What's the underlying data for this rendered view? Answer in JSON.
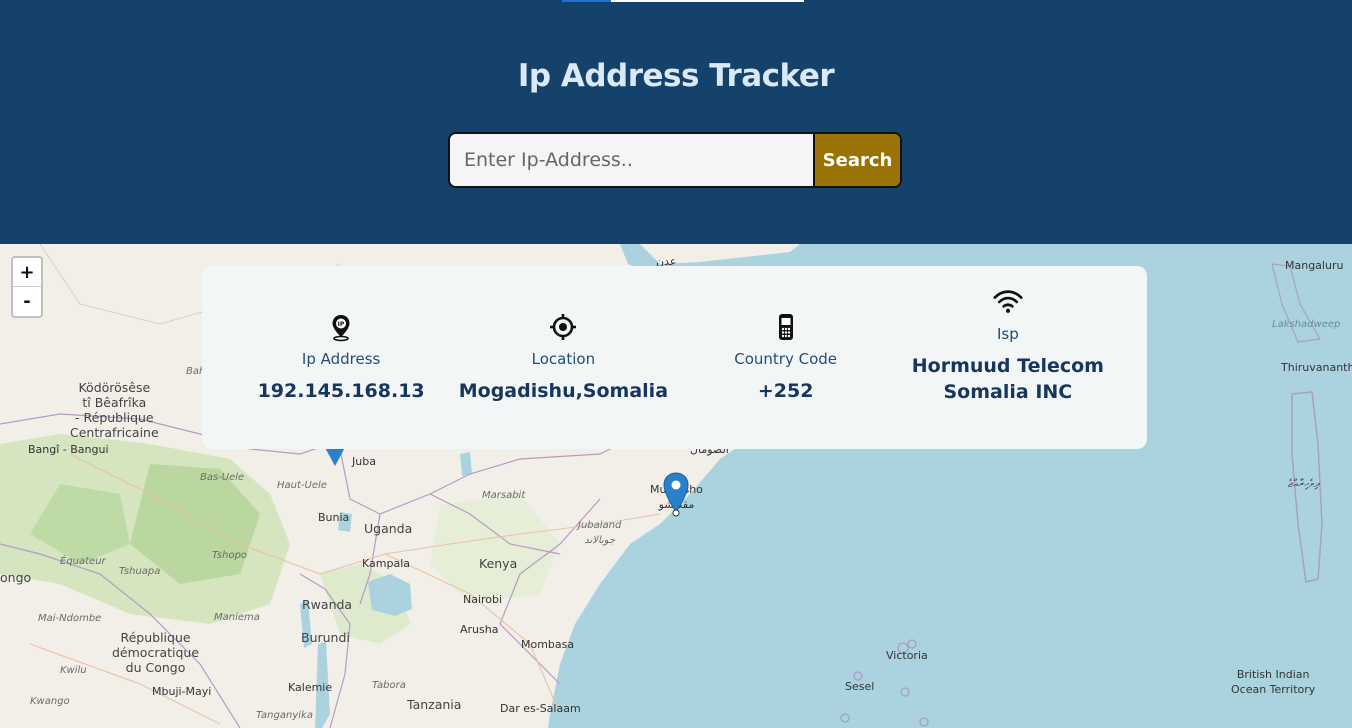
{
  "header": {
    "title": "Ip Address Tracker",
    "search": {
      "placeholder": "Enter Ip-Address..",
      "value": "",
      "button_label": "Search"
    }
  },
  "map": {
    "zoom_in_label": "+",
    "zoom_out_label": "-",
    "labels": {
      "aden": "عدن",
      "mangaluru": "Mangaluru",
      "lakshadweep": "Lakshadweep",
      "thiruvananth": "Thiruvananth",
      "kodorosese": "Ködörösêse\ntî Bêafrîka\n- République\nCentrafricaine",
      "bangui": "Bangî - Bangui",
      "bas_uele": "Bas-Uele",
      "haut_uele": "Haut-Uele",
      "juba": "Juba",
      "somali": "الصومال",
      "marsabit": "Marsabit",
      "mogadishu": "Muqdisho\nمقديشو",
      "bunia": "Bunia",
      "uganda": "Uganda",
      "kampala": "Kampala",
      "jubaland": "Jubaland\nجوبالاند",
      "equateur": "Équateur",
      "tshuapa": "Tshuapa",
      "tshopo": "Tshopo",
      "kenya": "Kenya",
      "ongo": "ongo",
      "rwanda": "Rwanda",
      "nairobi": "Nairobi",
      "mai_ndombe": "Mai-Ndombe",
      "maniema": "Maniema",
      "burundi": "Burundi",
      "arusha": "Arusha",
      "rdc": "République\ndémocratique\ndu Congo",
      "mombasa": "Mombasa",
      "kwilu": "Kwilu",
      "victoria": "Victoria",
      "mbuji_mayi": "Mbuji-Mayi",
      "kalemie": "Kalemie",
      "tabora": "Tabora",
      "sesel": "Sesel",
      "biot": "British Indian\nOcean Territory",
      "kwango": "Kwango",
      "tanganyika": "Tanganyika",
      "tanzania": "Tanzania",
      "dar": "Dar es-Salaam",
      "maldives": "ދިވެހިރާއްޖެ",
      "bah": "Bah"
    }
  },
  "result": {
    "ip": {
      "label": "Ip Address",
      "value": "192.145.168.13",
      "icon": "location-pin-ip-icon"
    },
    "location": {
      "label": "Location",
      "value": "Mogadishu,Somalia",
      "icon": "crosshair-icon"
    },
    "country_code": {
      "label": "Country Code",
      "value": "+252",
      "icon": "mobile-phone-icon"
    },
    "isp": {
      "label": "Isp",
      "value": "Hormuud Telecom Somalia INC",
      "icon": "wifi-icon"
    }
  },
  "colors": {
    "header_bg": "#14426b",
    "title": "#dbe8f6",
    "button_bg": "#9a7206",
    "card_bg": "#f3f6f7",
    "label": "#1f4e79",
    "value": "#17365d",
    "marker": "#2a81cb",
    "ocean": "#aad3df",
    "land": "#f2efe9"
  }
}
